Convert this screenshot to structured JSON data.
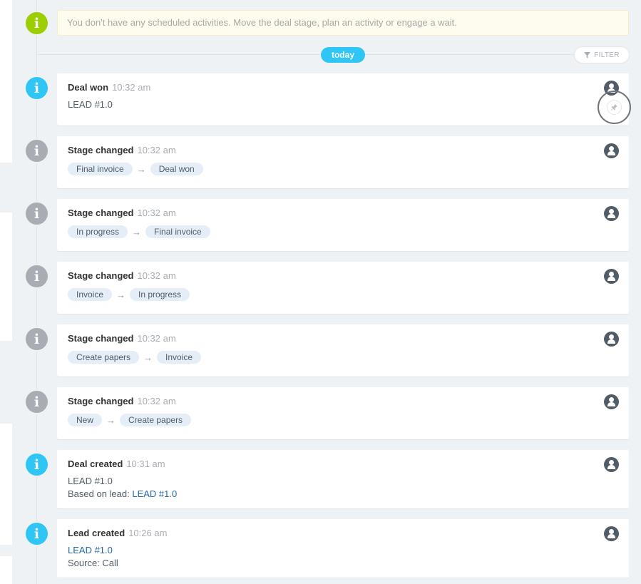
{
  "notice": {
    "icon": "info-icon",
    "text": "You don't have any scheduled activities. Move the deal stage, plan an activity or engage a wait."
  },
  "today_label": "today",
  "filter_label": "FILTER",
  "colors": {
    "accent_blue": "#2fc6f6",
    "accent_green": "#9dcf00",
    "muted_grey": "#a8adb4",
    "link": "#2067b0"
  },
  "events": [
    {
      "title": "Deal won",
      "time": "10:32 am",
      "line1": "LEAD #1.0",
      "dot": "blue"
    },
    {
      "title": "Stage changed",
      "time": "10:32 am",
      "from": "Final invoice",
      "to": "Deal won",
      "dot": "grey"
    },
    {
      "title": "Stage changed",
      "time": "10:32 am",
      "from": "In progress",
      "to": "Final invoice",
      "dot": "grey"
    },
    {
      "title": "Stage changed",
      "time": "10:32 am",
      "from": "Invoice",
      "to": "In progress",
      "dot": "grey"
    },
    {
      "title": "Stage changed",
      "time": "10:32 am",
      "from": "Create papers",
      "to": "Invoice",
      "dot": "grey"
    },
    {
      "title": "Stage changed",
      "time": "10:32 am",
      "from": "New",
      "to": "Create papers",
      "dot": "grey"
    },
    {
      "title": "Deal created",
      "time": "10:31 am",
      "line1": "LEAD #1.0",
      "line2_prefix": "Based on lead: ",
      "line2_link": "LEAD #1.0",
      "dot": "blue"
    },
    {
      "title": "Lead created",
      "time": "10:26 am",
      "line1_link": "LEAD #1.0",
      "line2": "Source: Call",
      "dot": "blue"
    }
  ],
  "arrow_glyph": "→",
  "info_glyph": "i"
}
